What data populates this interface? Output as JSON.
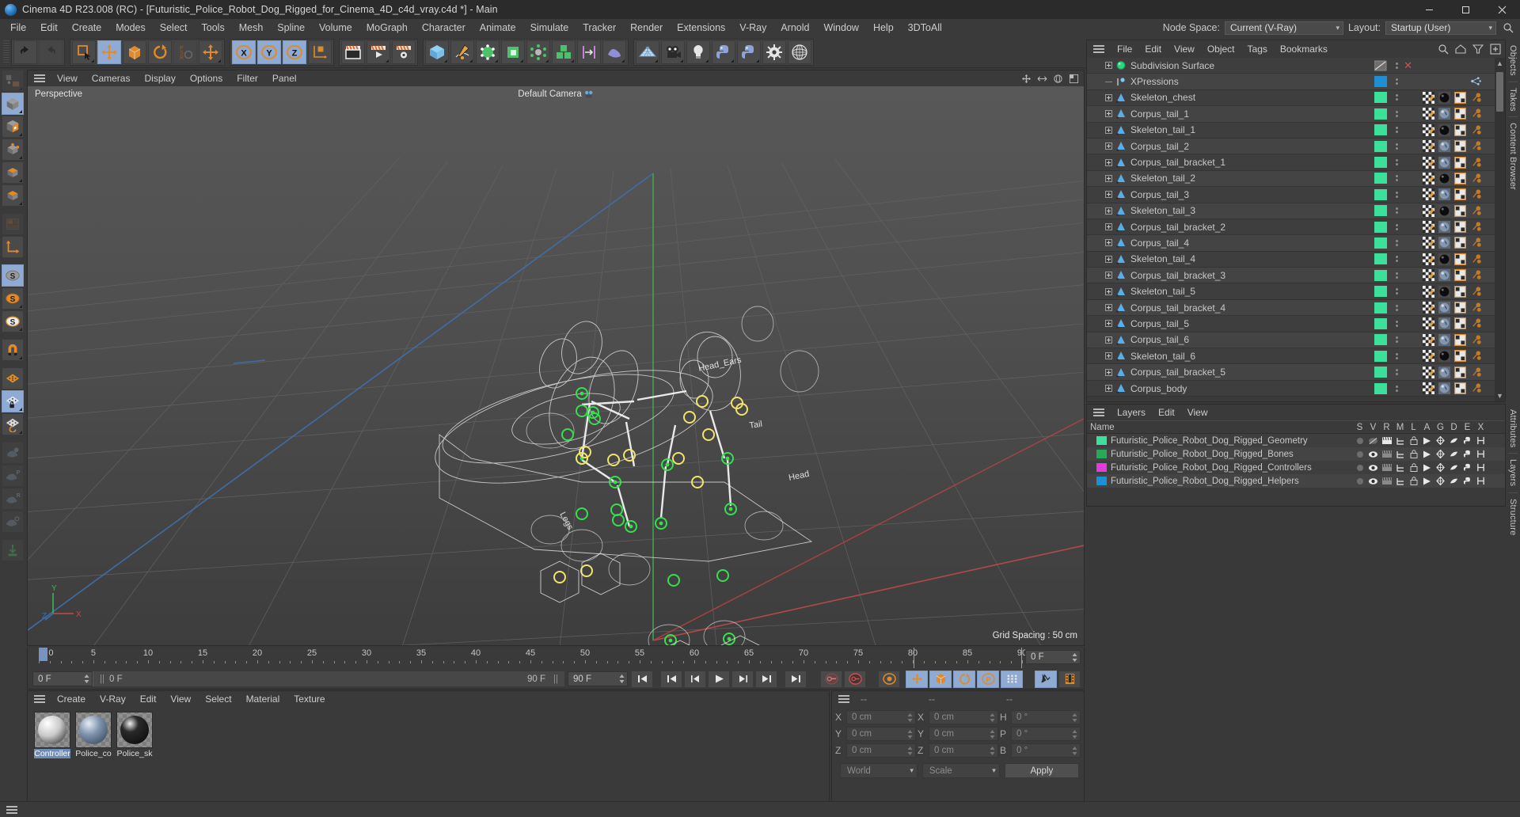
{
  "window": {
    "title": "Cinema 4D R23.008 (RC) - [Futuristic_Police_Robot_Dog_Rigged_for_Cinema_4D_c4d_vray.c4d *] - Main",
    "minimize": "–",
    "maximize": "□",
    "close": "✕"
  },
  "menubar": {
    "items": [
      "File",
      "Edit",
      "Create",
      "Modes",
      "Select",
      "Tools",
      "Mesh",
      "Spline",
      "Volume",
      "MoGraph",
      "Character",
      "Animate",
      "Simulate",
      "Tracker",
      "Render",
      "Extensions",
      "V-Ray",
      "Arnold",
      "Window",
      "Help",
      "3DToAll"
    ],
    "node_space_label": "Node Space:",
    "node_space_value": "Current (V-Ray)",
    "layout_label": "Layout:",
    "layout_value": "Startup (User)",
    "search_icon": "search-icon"
  },
  "viewport": {
    "menu": [
      "View",
      "Cameras",
      "Display",
      "Options",
      "Filter",
      "Panel"
    ],
    "label": "Perspective",
    "camera_label": "Default Camera",
    "grid_spacing": "Grid Spacing : 50 cm",
    "axis_labels": {
      "x": "X",
      "y": "Y",
      "z": "Z"
    },
    "annotations": [
      "Head_Ears",
      "Head",
      "Tail",
      "Legs"
    ]
  },
  "timeline": {
    "ticks": [
      0,
      5,
      10,
      15,
      20,
      25,
      30,
      35,
      40,
      45,
      50,
      55,
      60,
      65,
      70,
      75,
      80,
      85,
      90
    ],
    "current_frame_field": "0 F",
    "start_frame": "0 F",
    "current_frame": "0 F",
    "end_marker": "90 F",
    "end_frame_field": "90 F",
    "preview_min": "0 F",
    "transport_buttons": [
      "go-to-start",
      "previous-keyframe",
      "previous-frame",
      "play",
      "next-frame",
      "next-keyframe",
      "go-to-end"
    ]
  },
  "material_manager": {
    "menu": [
      "Create",
      "V-Ray",
      "Edit",
      "View",
      "Select",
      "Material",
      "Texture"
    ],
    "materials": [
      {
        "label": "Controller",
        "selected": true,
        "color": "#c9c9c9"
      },
      {
        "label": "Police_co",
        "selected": false,
        "color": "#7f93ad"
      },
      {
        "label": "Police_sk",
        "selected": false,
        "color": "#191919"
      }
    ]
  },
  "coordinates": {
    "header": [
      "--",
      "--",
      "--"
    ],
    "position_rows": [
      {
        "label": "X",
        "value": "0 cm"
      },
      {
        "label": "Y",
        "value": "0 cm"
      },
      {
        "label": "Z",
        "value": "0 cm"
      }
    ],
    "size_rows": [
      {
        "label": "X",
        "value": "0 cm"
      },
      {
        "label": "Y",
        "value": "0 cm"
      },
      {
        "label": "Z",
        "value": "0 cm"
      }
    ],
    "rotation_rows": [
      {
        "label": "H",
        "value": "0 °"
      },
      {
        "label": "P",
        "value": "0 °"
      },
      {
        "label": "B",
        "value": "0 °"
      }
    ],
    "system": "World",
    "mode": "Scale",
    "apply": "Apply"
  },
  "object_manager": {
    "menu": [
      "File",
      "Edit",
      "View",
      "Object",
      "Tags",
      "Bookmarks"
    ],
    "tools": [
      "search-icon",
      "home-icon",
      "filter-icon",
      "add-icon"
    ],
    "rows": [
      {
        "name": "Subdivision Surface",
        "type": "subdivision",
        "swatch": "#808080",
        "indent": 0,
        "expandable": true,
        "expanded": true,
        "tags": [],
        "close": true
      },
      {
        "name": "XPressions",
        "type": "xpresso",
        "swatch": "#1f8fd4",
        "indent": 1,
        "expandable": false,
        "tags": [
          "xpresso"
        ]
      },
      {
        "name": "Skeleton_chest",
        "type": "joint",
        "swatch": "#3ce09b",
        "indent": 1,
        "expandable": true,
        "tags": [
          "texture-check",
          "material-dark",
          "uv",
          "points"
        ]
      },
      {
        "name": "Corpus_tail_1",
        "type": "joint",
        "swatch": "#3ce09b",
        "indent": 1,
        "expandable": true,
        "tags": [
          "texture-check",
          "material-blue",
          "uv",
          "points"
        ]
      },
      {
        "name": "Skeleton_tail_1",
        "type": "joint",
        "swatch": "#3ce09b",
        "indent": 1,
        "expandable": true,
        "tags": [
          "texture-check",
          "material-dark",
          "uv",
          "points"
        ]
      },
      {
        "name": "Corpus_tail_2",
        "type": "joint",
        "swatch": "#3ce09b",
        "indent": 1,
        "expandable": true,
        "tags": [
          "texture-check",
          "material-blue",
          "uv",
          "points"
        ]
      },
      {
        "name": "Corpus_tail_bracket_1",
        "type": "joint",
        "swatch": "#3ce09b",
        "indent": 1,
        "expandable": true,
        "tags": [
          "texture-check",
          "material-blue",
          "uv",
          "points"
        ]
      },
      {
        "name": "Skeleton_tail_2",
        "type": "joint",
        "swatch": "#3ce09b",
        "indent": 1,
        "expandable": true,
        "tags": [
          "texture-check",
          "material-dark",
          "uv",
          "points"
        ]
      },
      {
        "name": "Corpus_tail_3",
        "type": "joint",
        "swatch": "#3ce09b",
        "indent": 1,
        "expandable": true,
        "tags": [
          "texture-check",
          "material-blue",
          "uv",
          "points"
        ]
      },
      {
        "name": "Skeleton_tail_3",
        "type": "joint",
        "swatch": "#3ce09b",
        "indent": 1,
        "expandable": true,
        "tags": [
          "texture-check",
          "material-dark",
          "uv",
          "points"
        ]
      },
      {
        "name": "Corpus_tail_bracket_2",
        "type": "joint",
        "swatch": "#3ce09b",
        "indent": 1,
        "expandable": true,
        "tags": [
          "texture-check",
          "material-blue",
          "uv",
          "points"
        ]
      },
      {
        "name": "Corpus_tail_4",
        "type": "joint",
        "swatch": "#3ce09b",
        "indent": 1,
        "expandable": true,
        "tags": [
          "texture-check",
          "material-blue",
          "uv",
          "points"
        ]
      },
      {
        "name": "Skeleton_tail_4",
        "type": "joint",
        "swatch": "#3ce09b",
        "indent": 1,
        "expandable": true,
        "tags": [
          "texture-check",
          "material-dark",
          "uv",
          "points"
        ]
      },
      {
        "name": "Corpus_tail_bracket_3",
        "type": "joint",
        "swatch": "#3ce09b",
        "indent": 1,
        "expandable": true,
        "tags": [
          "texture-check",
          "material-blue",
          "uv",
          "points"
        ]
      },
      {
        "name": "Skeleton_tail_5",
        "type": "joint",
        "swatch": "#3ce09b",
        "indent": 1,
        "expandable": true,
        "tags": [
          "texture-check",
          "material-dark",
          "uv",
          "points"
        ]
      },
      {
        "name": "Corpus_tail_bracket_4",
        "type": "joint",
        "swatch": "#3ce09b",
        "indent": 1,
        "expandable": true,
        "tags": [
          "texture-check",
          "material-blue",
          "uv",
          "points"
        ]
      },
      {
        "name": "Corpus_tail_5",
        "type": "joint",
        "swatch": "#3ce09b",
        "indent": 1,
        "expandable": true,
        "tags": [
          "texture-check",
          "material-blue",
          "uv",
          "points"
        ]
      },
      {
        "name": "Corpus_tail_6",
        "type": "joint",
        "swatch": "#3ce09b",
        "indent": 1,
        "expandable": true,
        "tags": [
          "texture-check",
          "material-blue",
          "uv",
          "points"
        ]
      },
      {
        "name": "Skeleton_tail_6",
        "type": "joint",
        "swatch": "#3ce09b",
        "indent": 1,
        "expandable": true,
        "tags": [
          "texture-check",
          "material-dark",
          "uv",
          "points"
        ]
      },
      {
        "name": "Corpus_tail_bracket_5",
        "type": "joint",
        "swatch": "#3ce09b",
        "indent": 1,
        "expandable": true,
        "tags": [
          "texture-check",
          "material-blue",
          "uv",
          "points"
        ]
      },
      {
        "name": "Corpus_body",
        "type": "joint",
        "swatch": "#3ce09b",
        "indent": 1,
        "expandable": true,
        "tags": [
          "texture-check",
          "material-blue",
          "uv",
          "points"
        ]
      }
    ]
  },
  "layers_manager": {
    "menu": [
      "Layers",
      "Edit",
      "View"
    ],
    "columns": [
      "Name",
      "S",
      "V",
      "R",
      "M",
      "L",
      "A",
      "G",
      "D",
      "E",
      "X"
    ],
    "rows": [
      {
        "name": "Futuristic_Police_Robot_Dog_Rigged_Geometry",
        "color": "#3ce09b",
        "visible": false
      },
      {
        "name": "Futuristic_Police_Robot_Dog_Rigged_Bones",
        "color": "#2aa85a",
        "visible": true
      },
      {
        "name": "Futuristic_Police_Robot_Dog_Rigged_Controllers",
        "color": "#e03ce0",
        "visible": true
      },
      {
        "name": "Futuristic_Police_Robot_Dog_Rigged_Helpers",
        "color": "#1f8fd4",
        "visible": true
      }
    ]
  },
  "right_tabs_top": [
    "Objects",
    "Takes",
    "Content Browser"
  ],
  "right_tabs_bottom": [
    "Attributes",
    "Layers",
    "Structure"
  ],
  "toolbar": {
    "groups": [
      {
        "buttons": [
          {
            "name": "undo-button",
            "icon": "undo"
          },
          {
            "name": "redo-button",
            "icon": "redo",
            "disabled": true
          }
        ]
      },
      {
        "buttons": [
          {
            "name": "live-selection-tool",
            "icon": "select"
          },
          {
            "name": "move-tool",
            "icon": "move",
            "active": true
          },
          {
            "name": "scale-tool",
            "icon": "scale"
          },
          {
            "name": "rotate-tool",
            "icon": "rotate"
          },
          {
            "name": "psr-tool",
            "icon": "psr",
            "disabled": true
          },
          {
            "name": "world-axis-tool",
            "icon": "axis-move"
          }
        ]
      },
      {
        "buttons": [
          {
            "name": "x-axis-lock",
            "icon": "axis-x",
            "active": true
          },
          {
            "name": "y-axis-lock",
            "icon": "axis-y",
            "active": true
          },
          {
            "name": "z-axis-lock",
            "icon": "axis-z",
            "active": true
          },
          {
            "name": "coordinate-system-toggle",
            "icon": "world-object"
          }
        ]
      },
      {
        "buttons": [
          {
            "name": "render-view-button",
            "icon": "render-view"
          },
          {
            "name": "render-to-picture-viewer-button",
            "icon": "render-pv"
          },
          {
            "name": "render-settings-button",
            "icon": "render-settings"
          }
        ]
      },
      {
        "buttons": [
          {
            "name": "cube-primitive-button",
            "icon": "cube"
          },
          {
            "name": "spline-pen-button",
            "icon": "pen"
          },
          {
            "name": "nurbs-button",
            "icon": "nurbs"
          },
          {
            "name": "array-button",
            "icon": "array"
          },
          {
            "name": "bend-deformer-button",
            "icon": "deformer"
          },
          {
            "name": "mograph-cloner-button",
            "icon": "cloner"
          },
          {
            "name": "scene-nodes-button",
            "icon": "scene-node"
          },
          {
            "name": "field-button",
            "icon": "field"
          }
        ]
      },
      {
        "buttons": [
          {
            "name": "floor-button",
            "icon": "floor"
          },
          {
            "name": "camera-button",
            "icon": "camera"
          },
          {
            "name": "light-button",
            "icon": "light"
          },
          {
            "name": "python-tag-button",
            "icon": "python"
          },
          {
            "name": "python-generator-button",
            "icon": "python2"
          },
          {
            "name": "gear-button",
            "icon": "gear"
          },
          {
            "name": "sphere-wire-button",
            "icon": "wire-sphere"
          }
        ]
      }
    ]
  },
  "left_toolbar": {
    "buttons": [
      {
        "name": "make-editable-button",
        "icon": "editable",
        "disabled": true
      },
      {
        "name": "model-mode-button",
        "icon": "model",
        "active": true
      },
      {
        "name": "texture-mode-button",
        "icon": "texture"
      },
      {
        "name": "points-mode-button",
        "icon": "points"
      },
      {
        "name": "edges-mode-button",
        "icon": "edges"
      },
      {
        "name": "polygons-mode-button",
        "icon": "polygons"
      },
      {
        "name": "uv-mode-button",
        "icon": "uv",
        "disabled": true
      },
      {
        "name": "axis-mode-button",
        "icon": "axis"
      },
      {
        "name": "enable-axis-button",
        "icon": "s-gray",
        "active": true
      },
      {
        "name": "viewport-solo-single-button",
        "icon": "s-orange"
      },
      {
        "name": "viewport-solo-hierarchy-button",
        "icon": "s-white"
      },
      {
        "name": "snap-button",
        "icon": "magnet"
      },
      {
        "name": "workplane-button",
        "icon": "workplane"
      },
      {
        "name": "lock-workplane-button",
        "icon": "workplane-lock",
        "active": true
      },
      {
        "name": "planar-workplane-button",
        "icon": "workplane-rotate"
      },
      {
        "name": "animate-selected-button",
        "icon": "anim",
        "disabled": true
      },
      {
        "name": "animate-position-button",
        "icon": "anim-p",
        "disabled": true
      },
      {
        "name": "animate-rotation-button",
        "icon": "anim-r",
        "disabled": true
      },
      {
        "name": "animate-scale-button",
        "icon": "anim-s",
        "disabled": true
      },
      {
        "name": "record-button",
        "icon": "record",
        "disabled": true
      }
    ]
  }
}
